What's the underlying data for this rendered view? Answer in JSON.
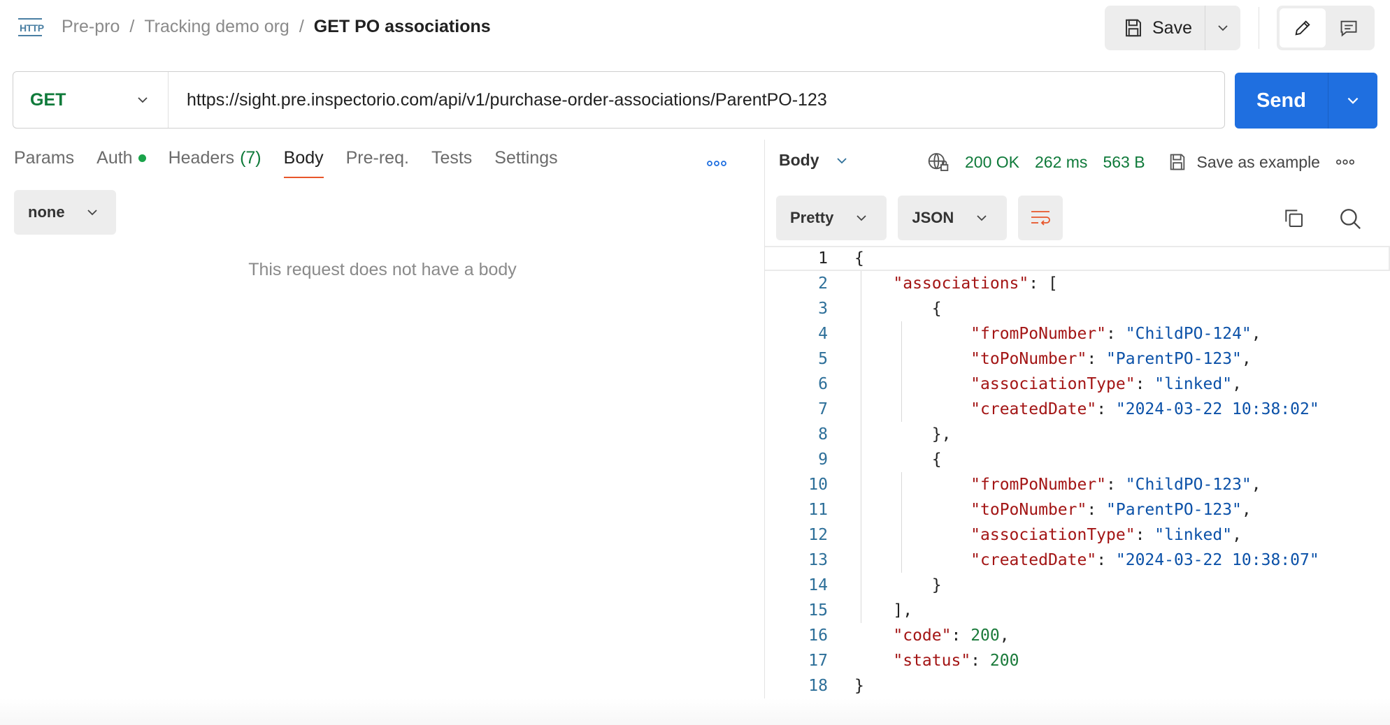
{
  "header": {
    "http_icon_text": "HTTP",
    "breadcrumb": [
      "Pre-pro",
      "Tracking demo org"
    ],
    "breadcrumb_sep": "/",
    "title": "GET PO associations",
    "save_label": "Save"
  },
  "request": {
    "method": "GET",
    "url": "https://sight.pre.inspectorio.com/api/v1/purchase-order-associations/ParentPO-123",
    "send_label": "Send",
    "tabs": [
      {
        "label": "Params"
      },
      {
        "label": "Auth"
      },
      {
        "label": "Headers",
        "count": "(7)"
      },
      {
        "label": "Body",
        "active": true
      },
      {
        "label": "Pre-req."
      },
      {
        "label": "Tests"
      },
      {
        "label": "Settings"
      }
    ],
    "body_type": "none",
    "empty_message": "This request does not have a body"
  },
  "response": {
    "view_label": "Body",
    "status": "200 OK",
    "time": "262 ms",
    "size": "563 B",
    "save_example_label": "Save as example",
    "format": "Pretty",
    "language": "JSON",
    "line_numbers": [
      "1",
      "2",
      "3",
      "4",
      "5",
      "6",
      "7",
      "8",
      "9",
      "10",
      "11",
      "12",
      "13",
      "14",
      "15",
      "16",
      "17",
      "18"
    ],
    "lines": [
      [
        {
          "t": "p",
          "v": "{"
        }
      ],
      [
        {
          "t": "p",
          "v": "    "
        },
        {
          "t": "k",
          "v": "\"associations\""
        },
        {
          "t": "p",
          "v": ": ["
        }
      ],
      [
        {
          "t": "p",
          "v": "        {"
        }
      ],
      [
        {
          "t": "p",
          "v": "            "
        },
        {
          "t": "k",
          "v": "\"fromPoNumber\""
        },
        {
          "t": "p",
          "v": ": "
        },
        {
          "t": "s",
          "v": "\"ChildPO-124\""
        },
        {
          "t": "p",
          "v": ","
        }
      ],
      [
        {
          "t": "p",
          "v": "            "
        },
        {
          "t": "k",
          "v": "\"toPoNumber\""
        },
        {
          "t": "p",
          "v": ": "
        },
        {
          "t": "s",
          "v": "\"ParentPO-123\""
        },
        {
          "t": "p",
          "v": ","
        }
      ],
      [
        {
          "t": "p",
          "v": "            "
        },
        {
          "t": "k",
          "v": "\"associationType\""
        },
        {
          "t": "p",
          "v": ": "
        },
        {
          "t": "s",
          "v": "\"linked\""
        },
        {
          "t": "p",
          "v": ","
        }
      ],
      [
        {
          "t": "p",
          "v": "            "
        },
        {
          "t": "k",
          "v": "\"createdDate\""
        },
        {
          "t": "p",
          "v": ": "
        },
        {
          "t": "s",
          "v": "\"2024-03-22 10:38:02\""
        }
      ],
      [
        {
          "t": "p",
          "v": "        },"
        }
      ],
      [
        {
          "t": "p",
          "v": "        {"
        }
      ],
      [
        {
          "t": "p",
          "v": "            "
        },
        {
          "t": "k",
          "v": "\"fromPoNumber\""
        },
        {
          "t": "p",
          "v": ": "
        },
        {
          "t": "s",
          "v": "\"ChildPO-123\""
        },
        {
          "t": "p",
          "v": ","
        }
      ],
      [
        {
          "t": "p",
          "v": "            "
        },
        {
          "t": "k",
          "v": "\"toPoNumber\""
        },
        {
          "t": "p",
          "v": ": "
        },
        {
          "t": "s",
          "v": "\"ParentPO-123\""
        },
        {
          "t": "p",
          "v": ","
        }
      ],
      [
        {
          "t": "p",
          "v": "            "
        },
        {
          "t": "k",
          "v": "\"associationType\""
        },
        {
          "t": "p",
          "v": ": "
        },
        {
          "t": "s",
          "v": "\"linked\""
        },
        {
          "t": "p",
          "v": ","
        }
      ],
      [
        {
          "t": "p",
          "v": "            "
        },
        {
          "t": "k",
          "v": "\"createdDate\""
        },
        {
          "t": "p",
          "v": ": "
        },
        {
          "t": "s",
          "v": "\"2024-03-22 10:38:07\""
        }
      ],
      [
        {
          "t": "p",
          "v": "        }"
        }
      ],
      [
        {
          "t": "p",
          "v": "    ],"
        }
      ],
      [
        {
          "t": "p",
          "v": "    "
        },
        {
          "t": "k",
          "v": "\"code\""
        },
        {
          "t": "p",
          "v": ": "
        },
        {
          "t": "n",
          "v": "200"
        },
        {
          "t": "p",
          "v": ","
        }
      ],
      [
        {
          "t": "p",
          "v": "    "
        },
        {
          "t": "k",
          "v": "\"status\""
        },
        {
          "t": "p",
          "v": ": "
        },
        {
          "t": "n",
          "v": "200"
        }
      ],
      [
        {
          "t": "p",
          "v": "}"
        }
      ]
    ]
  },
  "colors": {
    "accent_send": "#1f6fe0",
    "method_get": "#0f7a3a",
    "status_ok": "#0f7a3a",
    "active_tab_underline": "#e8562a",
    "json_key": "#a31515",
    "json_string": "#0b51a8",
    "json_number": "#1a7a3a"
  },
  "icons": [
    "http-icon",
    "save-icon",
    "chevron-down-icon",
    "pencil-icon",
    "comment-icon",
    "more-icon",
    "globe-lock-icon",
    "copy-icon",
    "search-icon",
    "wrap-lines-icon"
  ]
}
